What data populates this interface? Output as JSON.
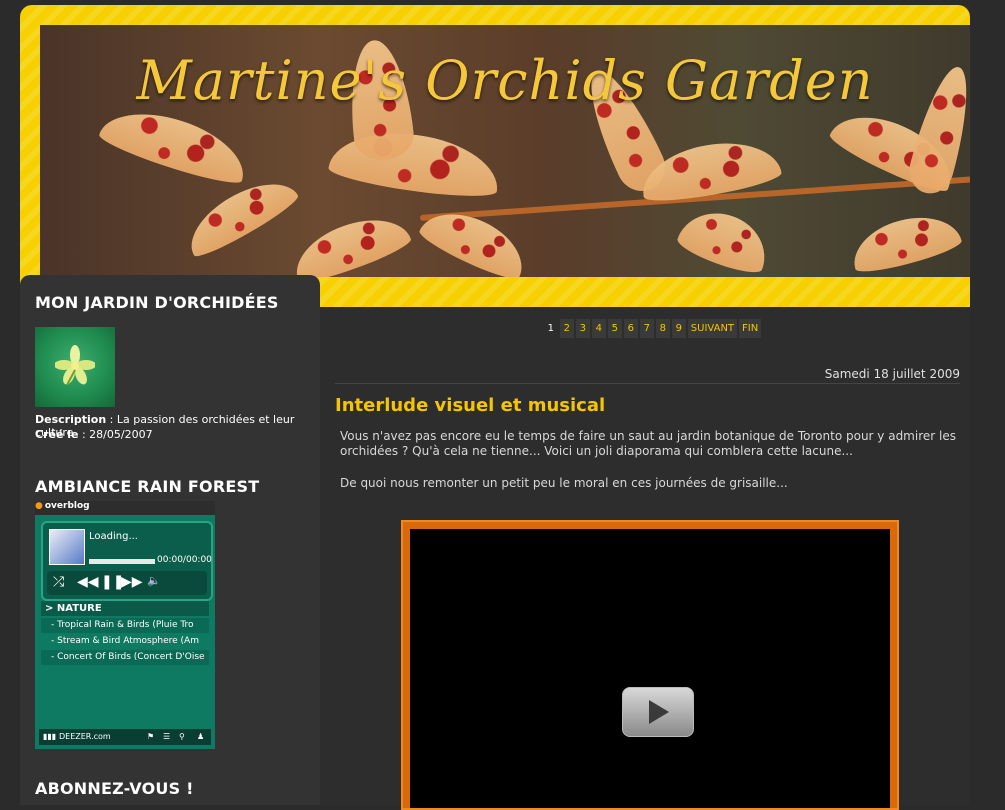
{
  "site": {
    "title": "Martine's Orchids Garden"
  },
  "sidebar": {
    "section1_title": "MON JARDIN D'ORCHIDÉES",
    "description_label": "Description",
    "description_value": " : La passion des orchidées et leur culture",
    "created_label": "Créé le",
    "created_value": " : 28/05/2007",
    "section2_title": "AMBIANCE RAIN FOREST",
    "section3_title": "ABONNEZ-VOUS !"
  },
  "player": {
    "brand": "overblog",
    "loading": "Loading...",
    "time": "00:00/00:00",
    "category": "> NATURE",
    "tracks": [
      "- Tropical Rain & Birds (Pluie Tro",
      "- Stream & Bird Atmosphere (Am",
      "- Concert Of Birds (Concert D'Oise"
    ],
    "footer": "DEEZER.com"
  },
  "pagination": {
    "current": "1",
    "pages": [
      "2",
      "3",
      "4",
      "5",
      "6",
      "7",
      "8",
      "9"
    ],
    "next": "SUIVANT",
    "last": "FIN"
  },
  "post": {
    "date": "Samedi 18 juillet 2009",
    "title": "Interlude visuel et musical",
    "para1": "Vous n'avez pas encore eu le temps de faire un saut au jardin botanique de Toronto pour y admirer les orchidées ? Qu'à cela ne tienne... Voici un joli diaporama qui comblera cette lacune...",
    "para2": "De quoi nous remonter un petit peu le moral en ces journées de grisaille..."
  },
  "icons": {
    "play": "play-icon",
    "shuffle": "shuffle-icon",
    "rewind": "rewind-icon",
    "pause": "pause-icon",
    "forward": "forward-icon",
    "volume": "volume-icon"
  },
  "colors": {
    "accent": "#f6c400",
    "header": "#f6d000",
    "player": "#0f7a62",
    "video_frame": "#d96a0c"
  }
}
